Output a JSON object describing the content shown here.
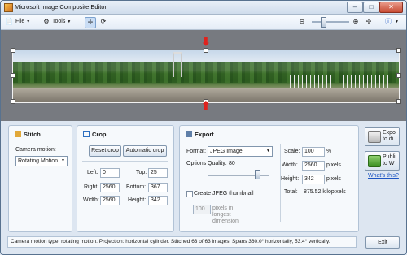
{
  "window": {
    "title": "Microsoft Image Composite Editor"
  },
  "toolbar": {
    "file_label": "File",
    "tools_label": "Tools"
  },
  "stitch": {
    "title": "Stitch",
    "camera_motion_label": "Camera motion:",
    "camera_motion_value": "Rotating Motion"
  },
  "crop": {
    "title": "Crop",
    "reset_label": "Reset crop",
    "auto_label": "Automatic crop",
    "left_label": "Left:",
    "left_value": "0",
    "top_label": "Top:",
    "top_value": "25",
    "right_label": "Right:",
    "right_value": "2560",
    "bottom_label": "Bottom:",
    "bottom_value": "367",
    "width_label": "Width:",
    "width_value": "2560",
    "height_label": "Height:",
    "height_value": "342"
  },
  "export": {
    "title": "Export",
    "format_label": "Format:",
    "format_value": "JPEG Image",
    "options_label": "Options",
    "quality_label": "Quality:",
    "quality_value": "80",
    "quality_fraction": 0.8,
    "thumbnail_label": "Create JPEG thumbnail",
    "thumb_size_value": "100",
    "thumb_hint_line1": "pixels in",
    "thumb_hint_line2": "longest",
    "thumb_hint_line3": "dimension",
    "scale_label": "Scale:",
    "scale_value": "100",
    "scale_unit": "%",
    "width_label": "Width:",
    "width_value": "2560",
    "width_unit": "pixels",
    "height_label": "Height:",
    "height_value": "342",
    "height_unit": "pixels",
    "total_label": "Total:",
    "total_value": "875.52 kilopixels"
  },
  "side": {
    "export_disk_line1": "Expo",
    "export_disk_line2": "to di",
    "publish_line1": "Publi",
    "publish_line2": "to W",
    "whats_this": "What's this?"
  },
  "status": {
    "text": "Camera motion type: rotating motion. Projection: horizontal cylinder. Stitched 63 of 63 images. Spans 360.0° horizontally, 53.4° vertically."
  },
  "exit_label": "Exit",
  "colors": {
    "accent_arrow": "#e0221c",
    "link": "#1d55c2"
  }
}
